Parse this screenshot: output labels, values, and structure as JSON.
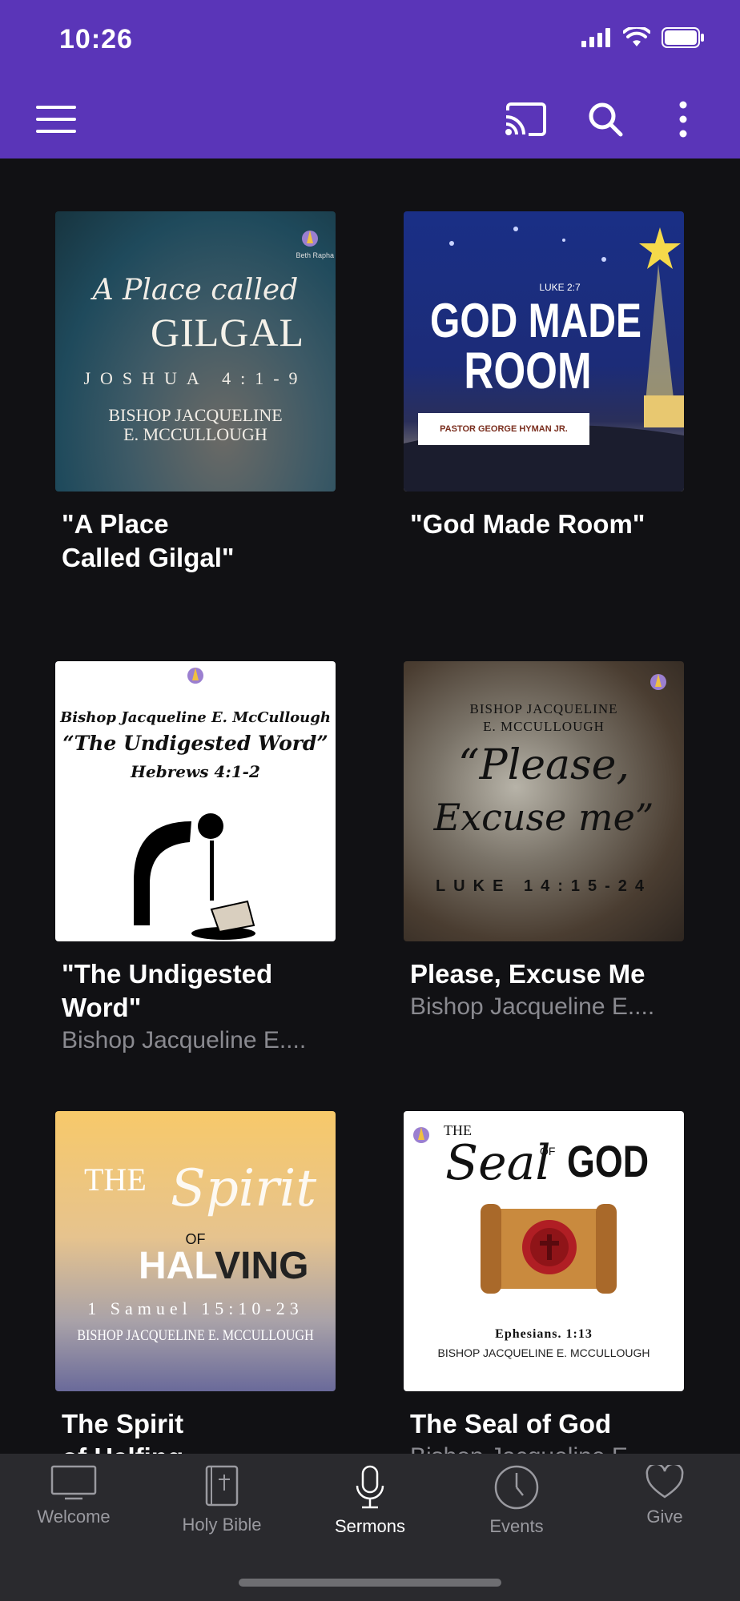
{
  "status": {
    "time": "10:26"
  },
  "colors": {
    "appbar": "#5a35b8",
    "background": "#111114",
    "tabbar": "#2a2a2e",
    "inactive": "#9a9aa0"
  },
  "toolbar": {
    "icons": [
      "menu-icon",
      "cast-icon",
      "search-icon",
      "more-vert-icon"
    ]
  },
  "sermons": [
    {
      "title": "\"A Place\nCalled Gilgal\"",
      "subtitle": "",
      "art": {
        "script": "A Place called",
        "main": "GILGAL",
        "ref": "JOSHUA 4:1-9",
        "author1": "BISHOP JACQUELINE",
        "author2": "E. MCCULLOUGH",
        "badge": "Beth Rapha"
      }
    },
    {
      "title": "\"God Made Room\"",
      "subtitle": "",
      "art": {
        "ref": "LUKE 2:7",
        "main1": "GOD MADE",
        "main2": "ROOM",
        "author": "PASTOR GEORGE HYMAN JR."
      }
    },
    {
      "title": "\"The Undigested\nWord\"",
      "subtitle": "Bishop Jacqueline E....",
      "art": {
        "line1": "Bishop Jacqueline E. McCullough",
        "line2": "“The Undigested Word”",
        "line3": "Hebrews 4:1-2",
        "badge": "Beth Rapha"
      }
    },
    {
      "title": "Please, Excuse Me",
      "subtitle": "Bishop Jacqueline E....",
      "art": {
        "author1": "BISHOP JACQUELINE",
        "author2": "E. MCCULLOUGH",
        "script1": "“Please,",
        "script2": "Excuse me”",
        "ref": "LUKE 14:15-24",
        "badge": "Beth Rapha"
      }
    },
    {
      "title": "The Spirit\nof Halfing",
      "subtitle": "",
      "art": {
        "the": "THE",
        "script": "Spirit",
        "of": "OF",
        "main1": "HAL",
        "main2": "VING",
        "ref": "1 Samuel 15:10-23",
        "author": "BISHOP JACQUELINE E. MCCULLOUGH"
      }
    },
    {
      "title": "The Seal of God",
      "subtitle": "Bishop Jacqueline E....",
      "art": {
        "the": "THE",
        "seal": "Seal",
        "of": "OF",
        "god": "GOD",
        "ref": "Ephesians. 1:13",
        "author": "BISHOP JACQUELINE E. MCCULLOUGH"
      }
    }
  ],
  "tabs": [
    {
      "label": "Welcome",
      "icon": "monitor-icon",
      "active": false
    },
    {
      "label": "Holy Bible",
      "icon": "bible-icon",
      "active": false
    },
    {
      "label": "Sermons",
      "icon": "microphone-icon",
      "active": true
    },
    {
      "label": "Events",
      "icon": "clock-icon",
      "active": false
    },
    {
      "label": "Give",
      "icon": "heart-icon",
      "active": false
    }
  ]
}
